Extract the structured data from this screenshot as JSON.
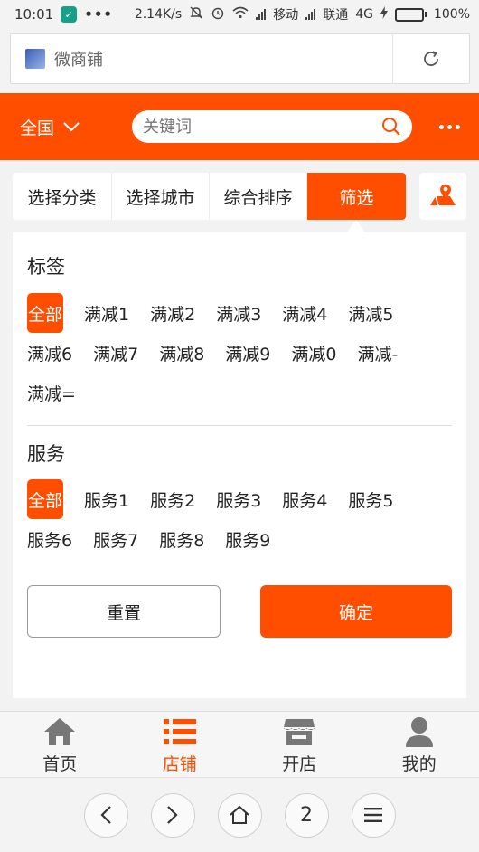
{
  "status": {
    "time": "10:01",
    "speed": "2.14K/s",
    "carrier1": "移动",
    "carrier2": "联通",
    "network": "4G",
    "battery": "100%",
    "battery_level": 1.0
  },
  "browser": {
    "page_title": "微商铺"
  },
  "header": {
    "region": "全国",
    "search_placeholder": "关键词",
    "accent": "#ff4e00"
  },
  "tabs": [
    {
      "label": "选择分类"
    },
    {
      "label": "选择城市"
    },
    {
      "label": "综合排序"
    },
    {
      "label": "筛选"
    }
  ],
  "filter": {
    "tags_title": "标签",
    "tags": [
      "全部",
      "满减1",
      "满减2",
      "满减3",
      "满减4",
      "满减5",
      "满减6",
      "满减7",
      "满减8",
      "满减9",
      "满减0",
      "满减-",
      "满减="
    ],
    "services_title": "服务",
    "services": [
      "全部",
      "服务1",
      "服务2",
      "服务3",
      "服务4",
      "服务5",
      "服务6",
      "服务7",
      "服务8",
      "服务9"
    ],
    "reset_label": "重置",
    "confirm_label": "确定"
  },
  "bottom_nav": [
    {
      "label": "首页",
      "icon": "home-icon"
    },
    {
      "label": "店铺",
      "icon": "list-icon"
    },
    {
      "label": "开店",
      "icon": "store-icon"
    },
    {
      "label": "我的",
      "icon": "user-icon"
    }
  ],
  "browser_bar": {
    "tab_count": "2"
  }
}
